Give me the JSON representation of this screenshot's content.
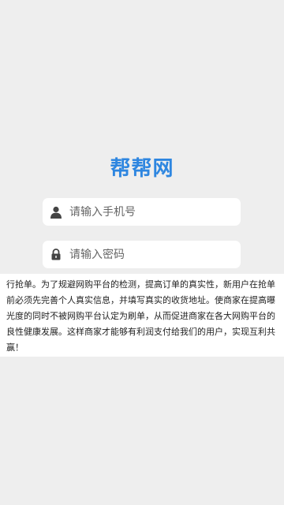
{
  "app": {
    "logo_text": "帮帮网"
  },
  "login": {
    "phone_placeholder": "请输入手机号",
    "password_placeholder": "请输入密码",
    "phone_icon": "user-icon",
    "password_icon": "lock-icon"
  },
  "notice": {
    "text": "行抢单。为了规避网购平台的检测，提高订单的真实性，新用户在抢单前必须先完善个人真实信息，并填写真实的收货地址。使商家在提高曝光度的同时不被网购平台认定为刷单，从而促进商家在各大网购平台的良性健康发展。这样商家才能够有利润支付给我们的用户，实现互利共赢！"
  },
  "colors": {
    "background": "#eeeeee",
    "logo": "#2e86e0",
    "field_bg": "#ffffff",
    "icon": "#444444"
  }
}
